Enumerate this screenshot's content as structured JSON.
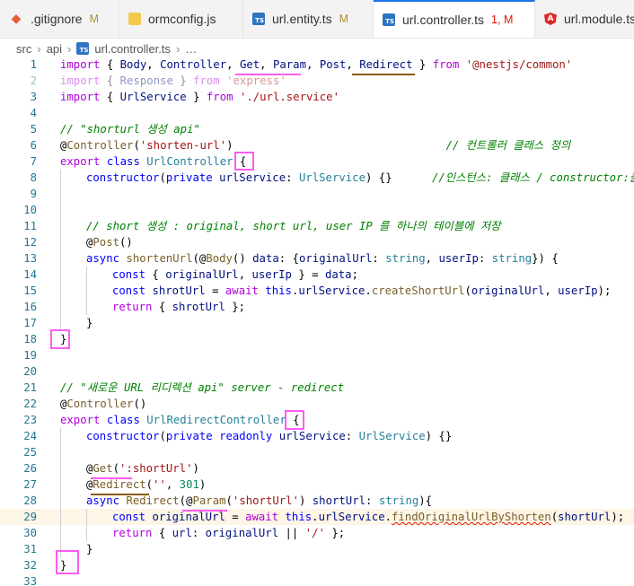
{
  "tabs": [
    {
      "icon": "git-icon",
      "name": ".gitignore",
      "status": "M",
      "status_color": "#b58a2a",
      "active": false
    },
    {
      "icon": "js-file-icon",
      "name": "ormconfig.js",
      "status": "",
      "active": false
    },
    {
      "icon": "ts-file-icon",
      "name": "url.entity.ts",
      "status": "M",
      "status_color": "#b58a2a",
      "active": false
    },
    {
      "icon": "ts-file-icon",
      "name": "url.controller.ts",
      "status": "1, M",
      "status_color": "#e51400",
      "active": true
    },
    {
      "icon": "angular-icon",
      "name": "url.module.ts",
      "status": "",
      "active": false
    }
  ],
  "breadcrumb": {
    "part1": "src",
    "part2": "api",
    "file": "url.controller.ts",
    "more": "…"
  },
  "editor": {
    "line_numbers": [
      "1",
      "2",
      "3",
      "4",
      "5",
      "6",
      "7",
      "8",
      "9",
      "10",
      "11",
      "12",
      "13",
      "14",
      "15",
      "16",
      "17",
      "18",
      "19",
      "20",
      "21",
      "22",
      "23",
      "24",
      "25",
      "26",
      "27",
      "28",
      "29",
      "30",
      "31",
      "32",
      "33"
    ],
    "colors": {
      "keyword": "#0000ff",
      "control": "#af00db",
      "type": "#267f99",
      "function": "#795e26",
      "string": "#a31515",
      "comment": "#008000",
      "annotation_box": "#ff5cf0"
    }
  },
  "code": {
    "l1": {
      "import": "import",
      "ob": " { ",
      "body": "Body",
      "c1": ", ",
      "controller": "Controller",
      "c2": ", ",
      "get": "Get",
      "c3": ", ",
      "param": "Param",
      "c4": ", ",
      "post": "Post",
      "c5": ", ",
      "redirect": "Redirect",
      "cb": " } ",
      "from": "from",
      "sp": " ",
      "mod": "'@nestjs/common'"
    },
    "l2": {
      "import": "import",
      "ob": " { ",
      "response": "Response",
      "cb": " } ",
      "from": "from",
      "sp": " ",
      "mod": "'express'"
    },
    "l3": {
      "import": "import",
      "ob": " { ",
      "svc": "UrlService",
      "cb": " } ",
      "from": "from",
      "sp": " ",
      "mod": "'./url.service'"
    },
    "l5": {
      "comment": "// \"shorturl 생성 api\""
    },
    "l6": {
      "at": "@",
      "dec": "Controller",
      "op": "(",
      "arg": "'shorten-url'",
      "cp": ")",
      "pad": "                                ",
      "comment": "// 컨트롤러 클래스 정의"
    },
    "l7": {
      "export": "export",
      "sp1": " ",
      "class": "class",
      "sp2": " ",
      "name": "UrlController",
      "sp3": " ",
      "brace": "{"
    },
    "l8": {
      "ctor": "constructor",
      "op": "(",
      "priv": "private",
      "sp": " ",
      "param": "urlService",
      "colon": ": ",
      "type": "UrlService",
      "rest": ") {}",
      "pad": "      ",
      "comment": "//인스턴스: 클래스 / constructor:클래스"
    },
    "l11": {
      "comment": "// short 생성 : original, short url, user IP 를 하나의 테이블에 저장"
    },
    "l12": {
      "at": "@",
      "dec": "Post",
      "rest": "()"
    },
    "l13": {
      "async": "async",
      "sp": " ",
      "fn": "shortenUrl",
      "op": "(",
      "at": "@",
      "dec": "Body",
      "p2": "() ",
      "data": "data",
      "c": ": {",
      "k1": "originalUrl",
      "t1": ": ",
      "ty1": "string",
      "s": ", ",
      "k2": "userIp",
      "t2": ": ",
      "ty2": "string",
      "end": "}) {"
    },
    "l14": {
      "const": "const",
      "ob": " { ",
      "v1": "originalUrl",
      "c": ", ",
      "v2": "userIp",
      "eq": " } = ",
      "v3": "data",
      "semi": ";"
    },
    "l15": {
      "const": "const",
      "sp": " ",
      "v1": "shrotUrl",
      "eq": " = ",
      "await": "await",
      "sp2": " ",
      "this": "this",
      "dot1": ".",
      "svc": "urlService",
      "dot2": ".",
      "fn": "createShortUrl",
      "op": "(",
      "a1": "originalUrl",
      "c": ", ",
      "a2": "userIp",
      "cp": ");"
    },
    "l16": {
      "ret": "return",
      "ob": " { ",
      "v": "shrotUrl",
      "cb": " };"
    },
    "l17": {
      "brace": "}"
    },
    "l18": {
      "brace": "}"
    },
    "l21": {
      "comment": "// \"새로운 URL 리디렉션 api\" server - redirect"
    },
    "l22": {
      "at": "@",
      "dec": "Controller",
      "rest": "()"
    },
    "l23": {
      "export": "export",
      "sp1": " ",
      "class": "class",
      "sp2": " ",
      "name": "UrlRedirectController",
      "sp3": " ",
      "brace": "{"
    },
    "l24": {
      "ctor": "constructor",
      "op": "(",
      "priv": "private",
      "sp": " ",
      "ro": "readonly",
      "sp2": " ",
      "param": "urlService",
      "colon": ": ",
      "type": "UrlService",
      "rest": ") {}"
    },
    "l26": {
      "at": "@",
      "dec": "Get",
      "op": "(",
      "arg": "':shortUrl'",
      "cp": ")"
    },
    "l27": {
      "at": "@",
      "dec": "Redirect",
      "op": "(",
      "arg": "''",
      "c": ", ",
      "num": "301",
      "cp": ")"
    },
    "l28": {
      "async": "async",
      "sp": " ",
      "fn": "Redirect",
      "op": "(",
      "at": "@",
      "dec": "Param",
      "p2": "(",
      "arg": "'shortUrl'",
      "p3": ") ",
      "v": "shortUrl",
      "c": ": ",
      "ty": "string",
      "end": "){"
    },
    "l29": {
      "const": "const",
      "sp": " ",
      "v1": "originalUrl",
      "eq": " = ",
      "await": "await",
      "sp2": " ",
      "this": "this",
      "dot1": ".",
      "svc": "urlService",
      "dot2": ".",
      "fn": "findOriginalUrlByShorten",
      "op": "(",
      "a1": "shortUrl",
      "cp": ");"
    },
    "l30": {
      "ret": "return",
      "ob": " { ",
      "k": "url",
      "c": ": ",
      "v": "originalUrl",
      "or": " || ",
      "s": "'/'",
      "cb": " };"
    },
    "l31": {
      "brace": "}"
    },
    "l32": {
      "brace": "}"
    }
  }
}
